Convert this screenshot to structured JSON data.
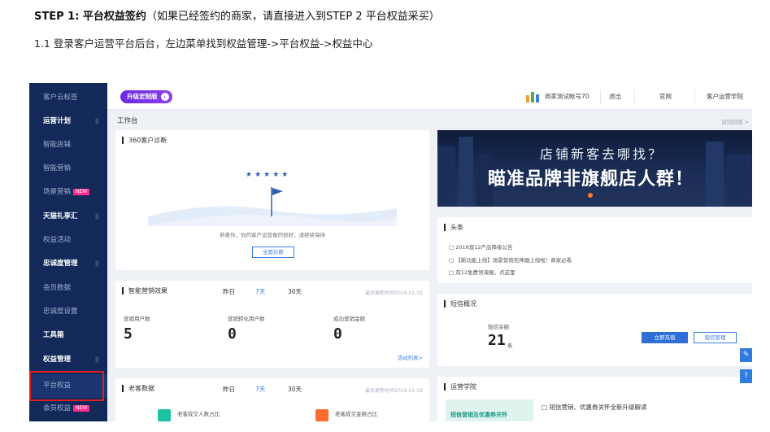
{
  "doc": {
    "step_bold": "STEP 1: 平台权益签约",
    "step_rest": "（如果已经签约的商家，请直接进入到STEP  2 平台权益采买）",
    "sub": "1.1 登录客户运营平台后台，左边菜单找到权益管理->平台权益->权益中心"
  },
  "sidebar": {
    "items": [
      {
        "label": "客户云标签",
        "bold": false,
        "chev": false
      },
      {
        "label": "运营计划",
        "bold": true,
        "chev": true
      },
      {
        "label": "智能店铺",
        "bold": false,
        "chev": false
      },
      {
        "label": "智能营销",
        "bold": false,
        "chev": false
      },
      {
        "label": "场景营销",
        "bold": false,
        "chev": false,
        "badge": "NEW"
      },
      {
        "label": "天猫礼享汇",
        "bold": true,
        "chev": true
      },
      {
        "label": "权益活动",
        "bold": false,
        "chev": false
      },
      {
        "label": "忠诚度管理",
        "bold": true,
        "chev": true
      },
      {
        "label": "会员数据",
        "bold": false,
        "chev": false
      },
      {
        "label": "忠诚度设置",
        "bold": false,
        "chev": false
      },
      {
        "label": "工具箱",
        "bold": true,
        "chev": false
      },
      {
        "label": "权益管理",
        "bold": true,
        "chev": true
      },
      {
        "label": "平台权益",
        "bold": false,
        "chev": false,
        "selected": true
      },
      {
        "label": "会员权益",
        "bold": false,
        "chev": false,
        "badge": "NEW"
      }
    ],
    "chev_glyph": "||"
  },
  "topbar": {
    "upgrade_label": "升级定制版",
    "upgrade_dot": "›",
    "merchant_name": "商家测试帐号70",
    "logout": "退出",
    "official_site": "官网",
    "academy": "客户运营学院"
  },
  "workbench": {
    "title": "工作台",
    "back_old": "返回旧版 >"
  },
  "diagnosis": {
    "title": "360客户诊断",
    "stars": "★★★★★",
    "text": "恭喜你，你的客户运营做的很好，请继续保持",
    "button": "全面诊断"
  },
  "banner": {
    "line1": "店铺新客去哪找？",
    "line2": "瞄准品牌非旗舰店人群！"
  },
  "news": {
    "title": "头条",
    "items": [
      "2018双12产品降级公告",
      "【新功能上线】场景营销包神器上线啦！商家必看",
      "双12免费领海报，点这里"
    ]
  },
  "marketing": {
    "title": "智能营销效果",
    "tabs": [
      "昨日",
      "7天",
      "30天"
    ],
    "updated": "最后更新时间2019-01-02",
    "metrics": [
      {
        "label": "营销用户数",
        "value": "5"
      },
      {
        "label": "营销转化用户数",
        "value": "0"
      },
      {
        "label": "成功营销金额",
        "value": "0"
      }
    ],
    "link": "活动列表>"
  },
  "sms": {
    "title": "短信概况",
    "balance_label": "短信余额",
    "balance_value": "21",
    "balance_unit": "条",
    "recharge": "立即充值",
    "manage": "短信管理"
  },
  "customers": {
    "title": "老客数据",
    "tabs": [
      "昨日",
      "7天",
      "30天"
    ],
    "updated": "最后更新时间2019-01-02",
    "metric1": "老客成交人数占比",
    "metric2": "老客成交金额占比"
  },
  "academy_card": {
    "title": "运营学院",
    "headline": "短信营销、优惠券关怀全新升级解读",
    "thumb_text": "短信营销及优惠券关怀"
  },
  "colors": {
    "sidebar_bg": "#12295a",
    "accent_blue": "#3a7ee0",
    "highlight_red": "#e02020",
    "upgrade_purple": "#7a33e8",
    "badge_pink": "#ff2d8a"
  }
}
